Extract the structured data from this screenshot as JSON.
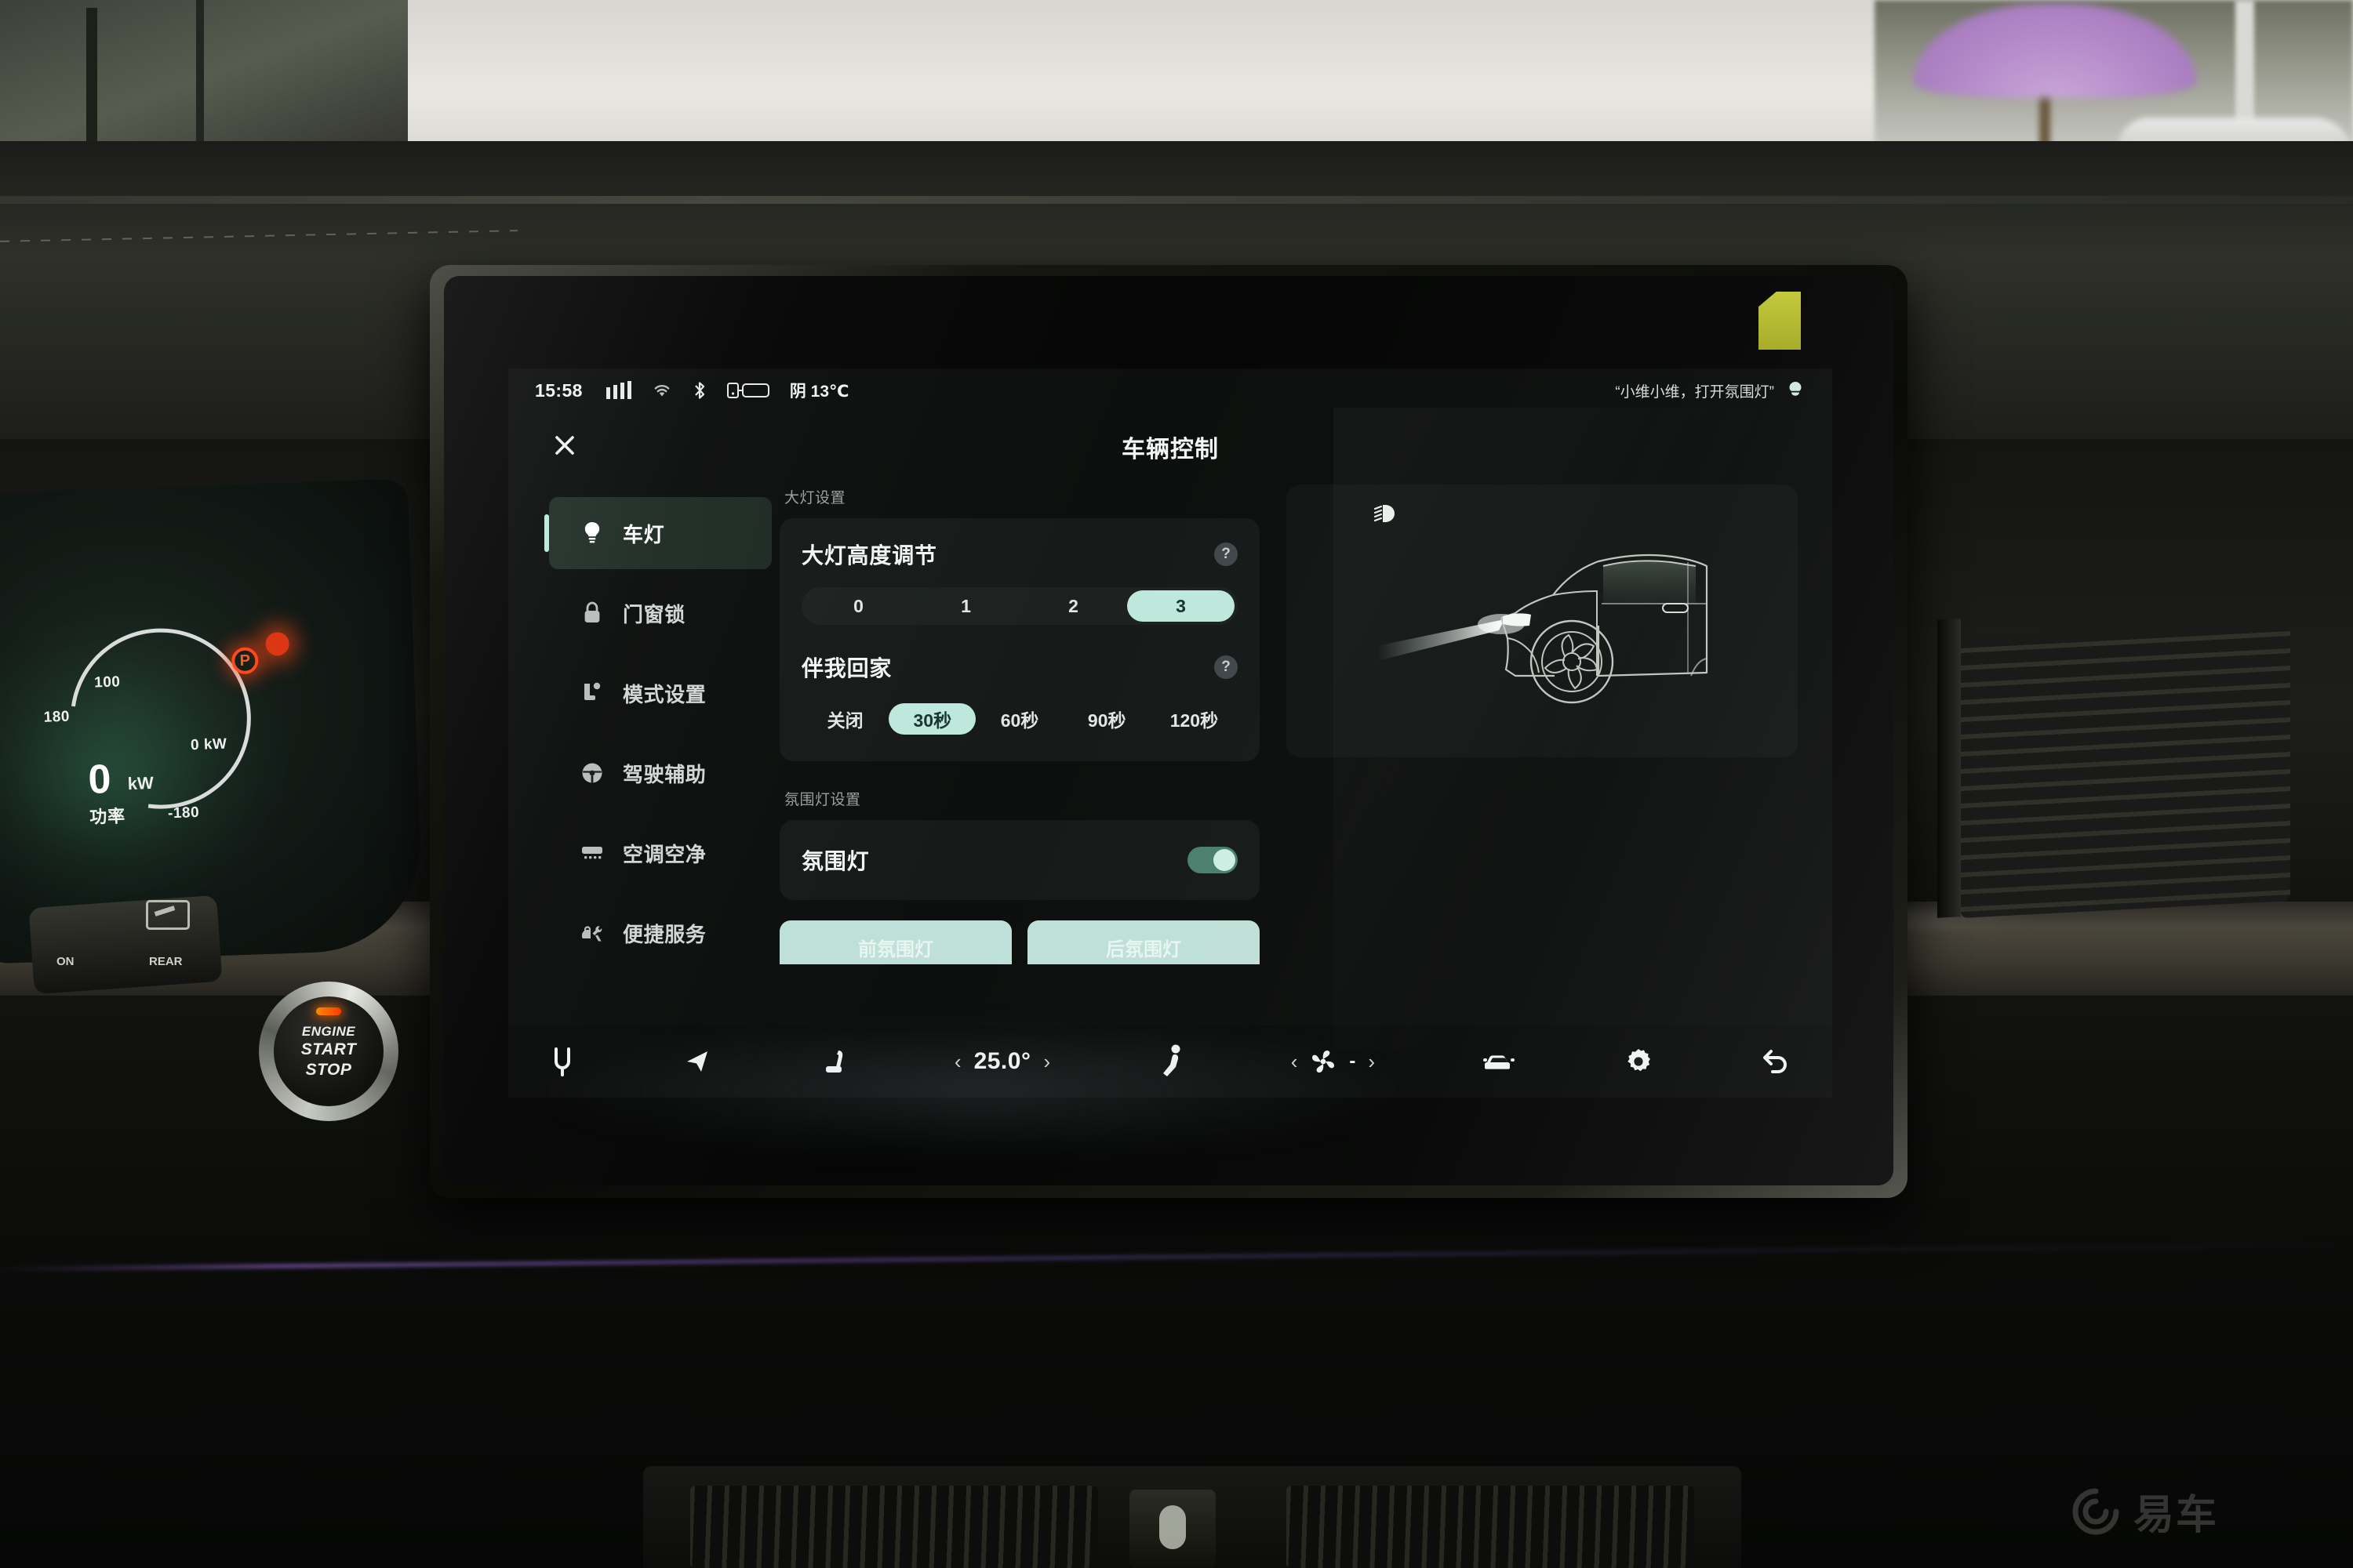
{
  "status_bar": {
    "time": "15:58",
    "signal_icon": "signal-bars-icon",
    "wifi_icon": "wifi-icon",
    "bluetooth_icon": "bluetooth-icon",
    "device_icon": "phone-link-icon",
    "weather": "阴 13℃",
    "voice_hint": "“小维小维，打开氛围灯”",
    "voice_icon": "voice-assistant-icon"
  },
  "header": {
    "close_icon": "close-icon",
    "title": "车辆控制"
  },
  "sidebar": {
    "items": [
      {
        "label": "车灯",
        "icon": "lightbulb-icon",
        "active": true
      },
      {
        "label": "门窗锁",
        "icon": "lock-icon",
        "active": false
      },
      {
        "label": "模式设置",
        "icon": "mode-settings-icon",
        "active": false
      },
      {
        "label": "驾驶辅助",
        "icon": "steering-wheel-icon",
        "active": false
      },
      {
        "label": "空调空净",
        "icon": "air-conditioner-icon",
        "active": false
      },
      {
        "label": "便捷服务",
        "icon": "service-wrench-icon",
        "active": false
      }
    ]
  },
  "main": {
    "headlight_group_title": "大灯设置",
    "headlight_height": {
      "label": "大灯高度调节",
      "help_icon": "help-icon",
      "help_label": "?",
      "options": [
        "0",
        "1",
        "2",
        "3"
      ],
      "selected": "3"
    },
    "follow_me_home": {
      "label": "伴我回家",
      "help_icon": "help-icon",
      "help_label": "?",
      "options": [
        "关闭",
        "30秒",
        "60秒",
        "90秒",
        "120秒"
      ],
      "selected": "30秒"
    },
    "ambient_group_title": "氛围灯设置",
    "ambient_light": {
      "label": "氛围灯",
      "toggle_state": "on"
    },
    "ambient_buttons": [
      {
        "label": "前氛围灯"
      },
      {
        "label": "后氛围灯"
      }
    ],
    "illustration": {
      "icon": "low-beam-headlight-icon",
      "description": "car-side-profile-with-headlight-beam"
    }
  },
  "bottom_bar": {
    "items": [
      {
        "name": "parking-brake-icon",
        "type": "icon"
      },
      {
        "name": "navigation-icon",
        "type": "icon"
      },
      {
        "name": "seat-heater-icon",
        "type": "icon"
      },
      {
        "name": "temperature-stepper",
        "type": "stepper",
        "value": "25.0°",
        "prev": "‹",
        "next": "›"
      },
      {
        "name": "seat-position-icon",
        "type": "icon"
      },
      {
        "name": "fan-stepper",
        "type": "stepper",
        "value": "-",
        "prev": "‹",
        "next": "›"
      },
      {
        "name": "vehicle-icon",
        "type": "icon"
      },
      {
        "name": "settings-gear-icon",
        "type": "icon"
      },
      {
        "name": "back-arrow-icon",
        "type": "icon"
      }
    ]
  },
  "cluster": {
    "tick_180": "180",
    "tick_100": "100",
    "tick_0kw": "0 kW",
    "tick_neg180": "-180",
    "power_value": "0",
    "power_unit": "kW",
    "power_label": "功率",
    "warning_icon": "parking-brake-warning-icon",
    "warning_glyph": "P"
  },
  "hardware": {
    "start_stop_line1": "ENGINE",
    "start_stop_line2": "START",
    "start_stop_line3": "STOP",
    "stalk_on": "ON",
    "stalk_rear": "REAR"
  },
  "watermark": {
    "text": "易车",
    "icon": "yiche-logo-icon"
  },
  "colors": {
    "accent_mint": "#bfe8dd",
    "screen_bg": "#0d0f0e",
    "card_bg": "#161a18",
    "toggle_on": "#4b7f6e",
    "badge_yellow": "#c3c83c",
    "warning_red": "#ff4a1e"
  }
}
